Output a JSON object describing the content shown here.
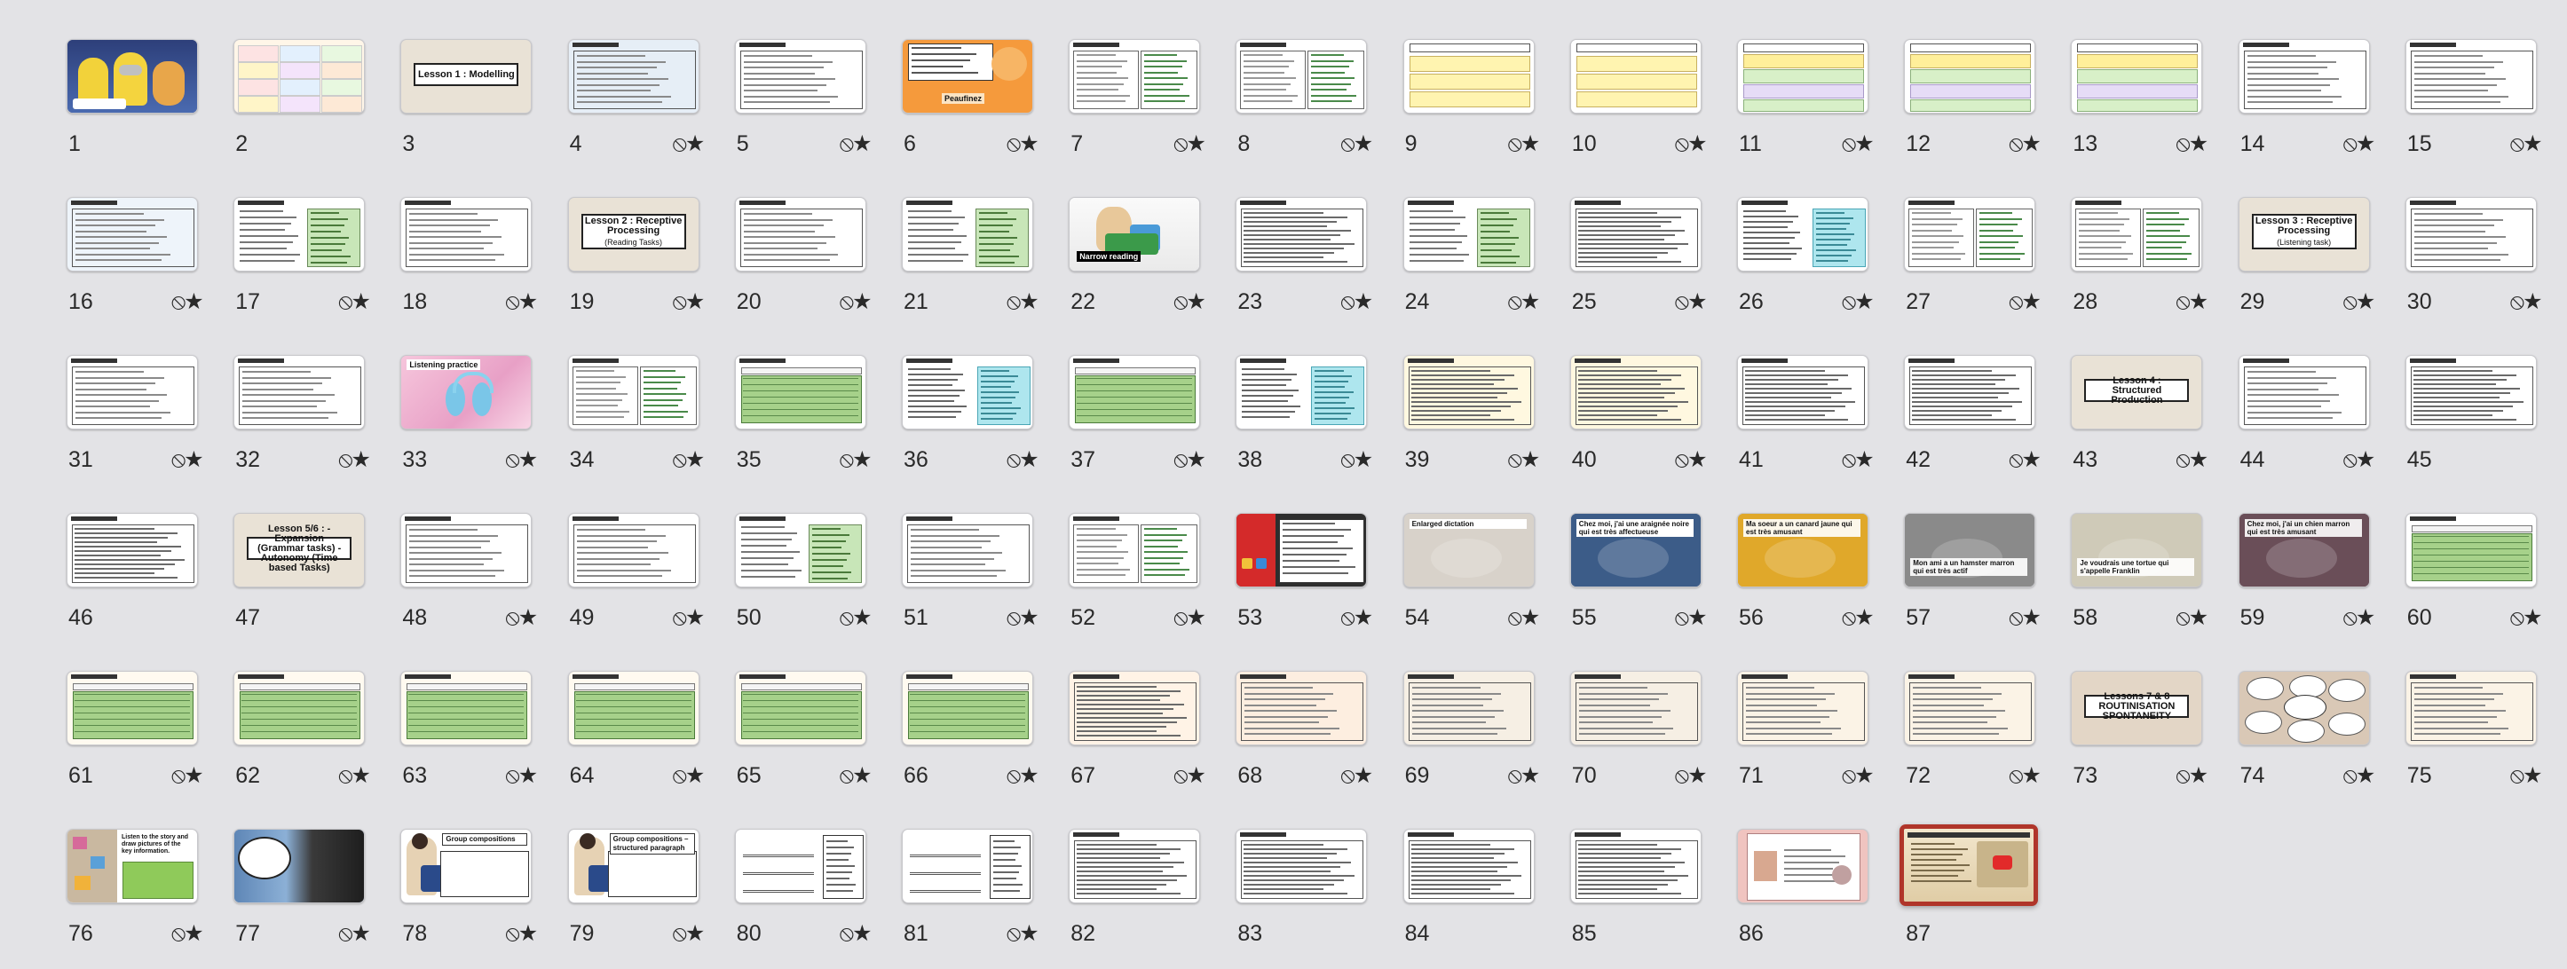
{
  "view": "slide-sorter",
  "icons": {
    "hide_toggle": "eye-slash-star-icon"
  },
  "colors": {
    "background": "#e3e3e6",
    "selection": "#b0352a"
  },
  "slides": [
    {
      "n": "1",
      "style": "cartoon",
      "bg": "#3a4e8a"
    },
    {
      "n": "2",
      "style": "colorgrid",
      "bg": "#fff6e8"
    },
    {
      "n": "3",
      "style": "lesson",
      "bg": "#e9e2d6",
      "title": "Lesson 1 : Modelling"
    },
    {
      "n": "4",
      "style": "list",
      "bg": "#e6eef6"
    },
    {
      "n": "5",
      "style": "list",
      "bg": "#ffffff"
    },
    {
      "n": "6",
      "style": "orange",
      "bg": "#f59a3c",
      "caption": "Peaufinez"
    },
    {
      "n": "7",
      "style": "table",
      "bg": "#ffffff"
    },
    {
      "n": "8",
      "style": "table",
      "bg": "#ffffff"
    },
    {
      "n": "9",
      "style": "yellowboxes",
      "bg": "#ffffff"
    },
    {
      "n": "10",
      "style": "yellowboxes",
      "bg": "#ffffff"
    },
    {
      "n": "11",
      "style": "greenboxes",
      "bg": "#ffffff"
    },
    {
      "n": "12",
      "style": "greenboxes",
      "bg": "#ffffff"
    },
    {
      "n": "13",
      "style": "greenboxes",
      "bg": "#ffffff"
    },
    {
      "n": "14",
      "style": "list",
      "bg": "#ffffff"
    },
    {
      "n": "15",
      "style": "list",
      "bg": "#ffffff"
    },
    {
      "n": "16",
      "style": "list",
      "bg": "#eef4fa"
    },
    {
      "n": "17",
      "style": "greencols",
      "bg": "#ffffff"
    },
    {
      "n": "18",
      "style": "list",
      "bg": "#ffffff"
    },
    {
      "n": "19",
      "style": "lesson",
      "bg": "#e9e2d6",
      "title": "Lesson 2 : Receptive Processing",
      "subtitle": "(Reading Tasks)"
    },
    {
      "n": "20",
      "style": "list",
      "bg": "#ffffff"
    },
    {
      "n": "21",
      "style": "greencols",
      "bg": "#ffffff"
    },
    {
      "n": "22",
      "style": "reading",
      "bg": "#ffffff",
      "caption": "Narrow reading"
    },
    {
      "n": "23",
      "style": "text",
      "bg": "#ffffff"
    },
    {
      "n": "24",
      "style": "greencols",
      "bg": "#ffffff"
    },
    {
      "n": "25",
      "style": "text",
      "bg": "#ffffff"
    },
    {
      "n": "26",
      "style": "cyancols",
      "bg": "#ffffff"
    },
    {
      "n": "27",
      "style": "table",
      "bg": "#ffffff"
    },
    {
      "n": "28",
      "style": "table",
      "bg": "#ffffff"
    },
    {
      "n": "29",
      "style": "lesson",
      "bg": "#e9e2d6",
      "title": "Lesson 3 : Receptive Processing",
      "subtitle": "(Listening task)"
    },
    {
      "n": "30",
      "style": "list",
      "bg": "#ffffff"
    },
    {
      "n": "31",
      "style": "list",
      "bg": "#ffffff"
    },
    {
      "n": "32",
      "style": "list",
      "bg": "#ffffff"
    },
    {
      "n": "33",
      "style": "headphones",
      "bg": "#f2b8d4",
      "caption": "Listening practice"
    },
    {
      "n": "34",
      "style": "table",
      "bg": "#ffffff"
    },
    {
      "n": "35",
      "style": "greenpanel",
      "bg": "#ffffff"
    },
    {
      "n": "36",
      "style": "cyancols",
      "bg": "#ffffff"
    },
    {
      "n": "37",
      "style": "greenpanel",
      "bg": "#ffffff"
    },
    {
      "n": "38",
      "style": "cyancols",
      "bg": "#ffffff"
    },
    {
      "n": "39",
      "style": "text",
      "bg": "#fff8e0"
    },
    {
      "n": "40",
      "style": "text",
      "bg": "#fff8e0"
    },
    {
      "n": "41",
      "style": "text",
      "bg": "#ffffff"
    },
    {
      "n": "42",
      "style": "text",
      "bg": "#ffffff"
    },
    {
      "n": "43",
      "style": "lesson",
      "bg": "#e9e2d6",
      "title": "Lesson 4 : Structured Production"
    },
    {
      "n": "44",
      "style": "list",
      "bg": "#ffffff"
    },
    {
      "n": "45",
      "style": "text",
      "bg": "#ffffff"
    },
    {
      "n": "46",
      "style": "text",
      "bg": "#ffffff"
    },
    {
      "n": "47",
      "style": "lesson",
      "bg": "#e9e2d6",
      "title": "Lesson 5/6 : -Expansion (Grammar tasks) -Autonomy (Time based Tasks)"
    },
    {
      "n": "48",
      "style": "list",
      "bg": "#ffffff"
    },
    {
      "n": "49",
      "style": "list",
      "bg": "#ffffff"
    },
    {
      "n": "50",
      "style": "greencols",
      "bg": "#ffffff"
    },
    {
      "n": "51",
      "style": "list",
      "bg": "#ffffff"
    },
    {
      "n": "52",
      "style": "table",
      "bg": "#ffffff"
    },
    {
      "n": "53",
      "style": "dark",
      "bg": "#2e2e2e"
    },
    {
      "n": "54",
      "style": "photo",
      "bg": "#d8d2ca",
      "caption": "Enlarged dictation"
    },
    {
      "n": "55",
      "style": "photo",
      "bg": "#3c5c88",
      "caption": "Chez moi, j'ai une araignée noire qui est très affectueuse"
    },
    {
      "n": "56",
      "style": "photo",
      "bg": "#e0a82a",
      "caption": "Ma soeur a un canard jaune qui est très amusant"
    },
    {
      "n": "57",
      "style": "photo",
      "bg": "#8a8a8a",
      "caption": "Mon ami a un hamster marron qui est très actif"
    },
    {
      "n": "58",
      "style": "photo",
      "bg": "#cfcab8",
      "caption": "Je voudrais une tortue qui s'appelle Franklin"
    },
    {
      "n": "59",
      "style": "photo",
      "bg": "#6a4e58",
      "caption": "Chez moi, j'ai un chien marron qui est très amusant"
    },
    {
      "n": "60",
      "style": "greenpanel",
      "bg": "#ffffff"
    },
    {
      "n": "61",
      "style": "greenpanel",
      "bg": "#fffaf0"
    },
    {
      "n": "62",
      "style": "greenpanel",
      "bg": "#fffaf0"
    },
    {
      "n": "63",
      "style": "greenpanel",
      "bg": "#fffaf0"
    },
    {
      "n": "64",
      "style": "greenpanel",
      "bg": "#fffaf0"
    },
    {
      "n": "65",
      "style": "greenpanel",
      "bg": "#fffaf0"
    },
    {
      "n": "66",
      "style": "greenpanel",
      "bg": "#fffaf0"
    },
    {
      "n": "67",
      "style": "text",
      "bg": "#fff3e6"
    },
    {
      "n": "68",
      "style": "list",
      "bg": "#fdeee0"
    },
    {
      "n": "69",
      "style": "list",
      "bg": "#f6efe4"
    },
    {
      "n": "70",
      "style": "list",
      "bg": "#f6efe4"
    },
    {
      "n": "71",
      "style": "list",
      "bg": "#fbf3e6"
    },
    {
      "n": "72",
      "style": "list",
      "bg": "#fbf3e6"
    },
    {
      "n": "73",
      "style": "lesson",
      "bg": "#e3d6c6",
      "title": "Lessons 7 & 8 ROUTINISATION SPONTANEITY"
    },
    {
      "n": "74",
      "style": "bubbles",
      "bg": "#d9c8b6"
    },
    {
      "n": "75",
      "style": "list",
      "bg": "#fbf3e6"
    },
    {
      "n": "76",
      "style": "listen",
      "bg": "#ffffff",
      "caption": "Listen to the story and draw pictures of the key information."
    },
    {
      "n": "77",
      "style": "books",
      "bg": "#6e8fb8"
    },
    {
      "n": "78",
      "style": "groupcomp",
      "bg": "#ffffff",
      "caption": "Group compositions"
    },
    {
      "n": "79",
      "style": "groupcomp",
      "bg": "#ffffff",
      "caption": "Group compositions – structured paragraph"
    },
    {
      "n": "80",
      "style": "letters",
      "bg": "#ffffff"
    },
    {
      "n": "81",
      "style": "letters",
      "bg": "#ffffff"
    },
    {
      "n": "82",
      "style": "text",
      "bg": "#ffffff"
    },
    {
      "n": "83",
      "style": "text",
      "bg": "#ffffff"
    },
    {
      "n": "84",
      "style": "text",
      "bg": "#ffffff"
    },
    {
      "n": "85",
      "style": "text",
      "bg": "#ffffff"
    },
    {
      "n": "86",
      "style": "pinkcard",
      "bg": "#f0c4c0"
    },
    {
      "n": "87",
      "style": "video",
      "bg": "#e8d8b8",
      "selected": true
    }
  ]
}
